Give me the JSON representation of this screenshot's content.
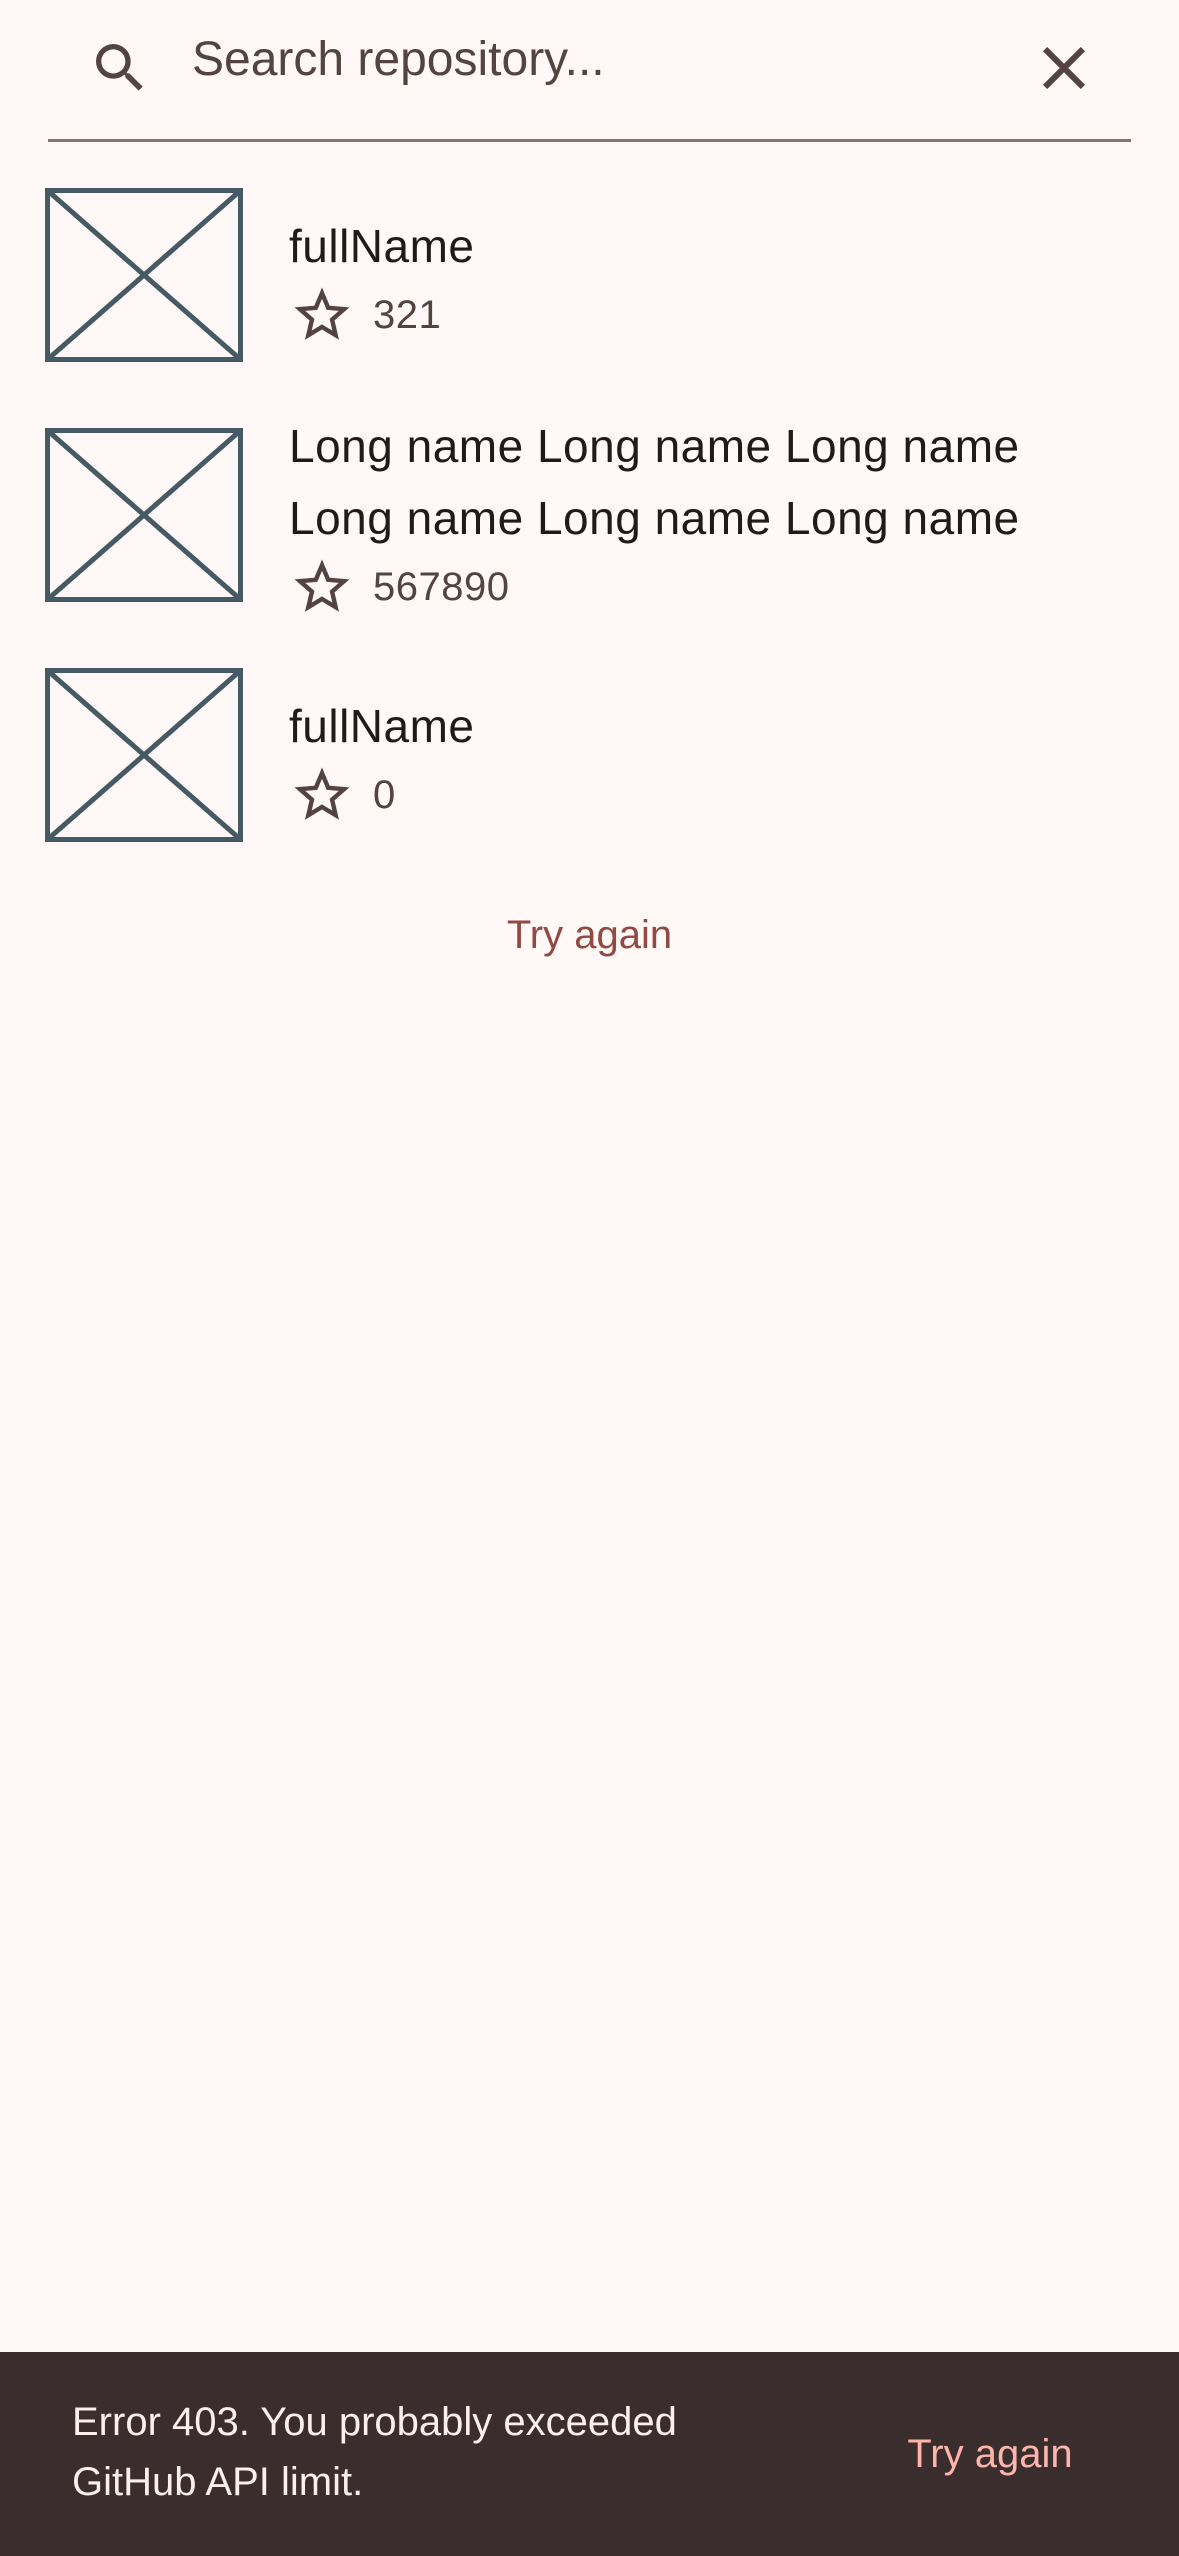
{
  "search": {
    "placeholder": "Search repository...",
    "value": ""
  },
  "repositories": [
    {
      "name": "fullName",
      "stars": "321",
      "avatar_icon": "broken-image-icon"
    },
    {
      "name": "Long name Long name Long name Long name Long name Long name",
      "stars": "567890",
      "avatar_icon": "broken-image-icon"
    },
    {
      "name": "fullName",
      "stars": "0",
      "avatar_icon": "broken-image-icon"
    }
  ],
  "list_retry_label": "Try again",
  "snackbar": {
    "message": "Error 403. You probably exceeded GitHub API limit.",
    "action_label": "Try again"
  },
  "icons": {
    "search": "search-icon",
    "clear": "close-icon",
    "star": "star-outline-icon",
    "placeholder": "broken-image-icon"
  },
  "colors": {
    "background": "#fff8f6",
    "primary": "#904a43",
    "on_surface": "#231918",
    "on_surface_variant": "#534341",
    "outline": "#857371",
    "placeholder_frame": "#455a64",
    "snackbar_bg": "#392e2d",
    "snackbar_text": "#fbeeec",
    "snackbar_action": "#ffb4ab"
  }
}
